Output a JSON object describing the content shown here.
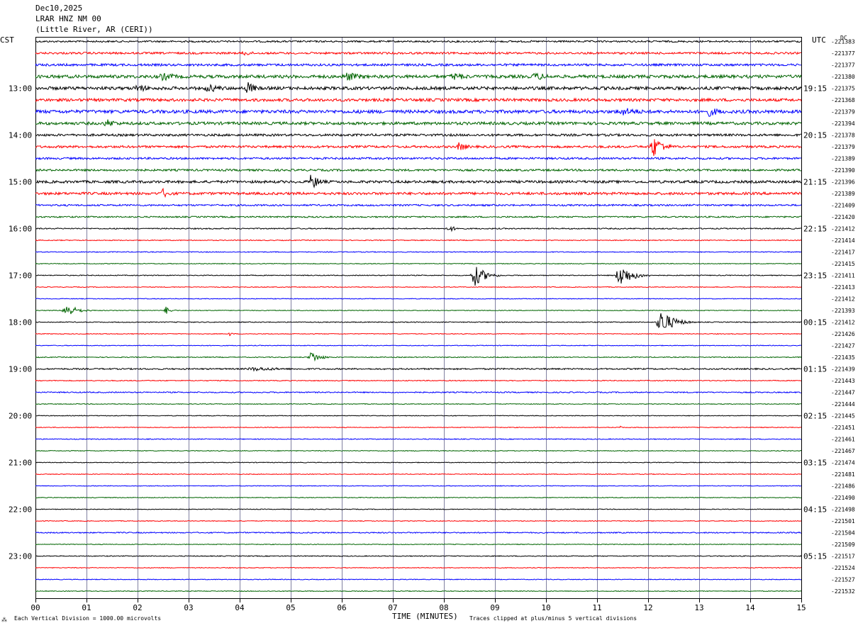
{
  "header": {
    "date": "Dec10,2025",
    "station": "LRAR HNZ NM 00",
    "location": "(Little River, AR (CERI))"
  },
  "left_axis_title": "CST",
  "right_axis_title": "UTC",
  "dc_label": "DC",
  "footer": {
    "scale_note": "Each Vertical Division = 1000.00 microvolts",
    "xlabel": "TIME (MINUTES)",
    "clip_note": "Traces clipped at plus/minus 5 vertical divisions"
  },
  "colors": {
    "cycle": [
      "#000000",
      "#ff0000",
      "#0000ff",
      "#006400"
    ],
    "grid": "#8080a0"
  },
  "chart_data": {
    "type": "line",
    "title": "LRAR HNZ NM 00 (Little River, AR (CERI)) Dec10,2025",
    "xlabel": "TIME (MINUTES)",
    "xlim": [
      0,
      15
    ],
    "x_ticks": [
      "00",
      "01",
      "02",
      "03",
      "04",
      "05",
      "06",
      "07",
      "08",
      "09",
      "10",
      "11",
      "12",
      "13",
      "14",
      "15"
    ],
    "cst_hour_labels": [
      "13:00",
      "14:00",
      "15:00",
      "16:00",
      "17:00",
      "18:00",
      "19:00",
      "20:00",
      "21:00",
      "22:00",
      "23:00"
    ],
    "utc_hour_labels": [
      "19:15",
      "20:15",
      "21:15",
      "22:15",
      "23:15",
      "00:15",
      "01:15",
      "02:15",
      "03:15",
      "04:15",
      "05:15"
    ],
    "dc_offsets": [
      "-221383",
      "-221377",
      "-221377",
      "-221380",
      "-221375",
      "-221368",
      "-221379",
      "-221394",
      "-221378",
      "-221379",
      "-221389",
      "-221390",
      "-221396",
      "-221389",
      "-221409",
      "-221420",
      "-221412",
      "-221414",
      "-221417",
      "-221415",
      "-221411",
      "-221413",
      "-221412",
      "-221393",
      "-221412",
      "-221426",
      "-221427",
      "-221435",
      "-221439",
      "-221443",
      "-221447",
      "-221444",
      "-221445",
      "-221451",
      "-221461",
      "-221467",
      "-221474",
      "-221481",
      "-221486",
      "-221490",
      "-221498",
      "-221501",
      "-221504",
      "-221509",
      "-221517",
      "-221524",
      "-221527",
      "-221532"
    ],
    "trace_noise": [
      1.2,
      1.4,
      1.6,
      2.2,
      2.2,
      2.0,
      2.3,
      2.0,
      1.6,
      1.6,
      1.4,
      1.4,
      1.8,
      1.8,
      1.2,
      1.0,
      0.8,
      0.6,
      0.6,
      0.5,
      0.6,
      0.5,
      0.5,
      0.5,
      0.6,
      0.5,
      0.5,
      0.6,
      1.0,
      0.6,
      0.8,
      0.5,
      0.5,
      0.5,
      0.6,
      0.5,
      0.5,
      0.5,
      0.5,
      0.5,
      0.5,
      0.5,
      0.8,
      0.5,
      0.6,
      0.5,
      0.5,
      0.5
    ],
    "events": [
      {
        "trace": 1,
        "minute": 4.1,
        "amp": 4,
        "dur": 0.6
      },
      {
        "trace": 3,
        "minute": 2.5,
        "amp": 6,
        "dur": 1.0
      },
      {
        "trace": 3,
        "minute": 6.1,
        "amp": 7,
        "dur": 1.0
      },
      {
        "trace": 3,
        "minute": 8.2,
        "amp": 6,
        "dur": 1.0
      },
      {
        "trace": 3,
        "minute": 9.8,
        "amp": 6,
        "dur": 1.0
      },
      {
        "trace": 4,
        "minute": 2.0,
        "amp": 6,
        "dur": 0.8
      },
      {
        "trace": 4,
        "minute": 3.4,
        "amp": 6,
        "dur": 1.0
      },
      {
        "trace": 4,
        "minute": 4.15,
        "amp": 10,
        "dur": 0.5
      },
      {
        "trace": 6,
        "minute": 11.5,
        "amp": 6,
        "dur": 1.5
      },
      {
        "trace": 6,
        "minute": 13.2,
        "amp": 7,
        "dur": 0.8
      },
      {
        "trace": 7,
        "minute": 1.4,
        "amp": 6,
        "dur": 0.8
      },
      {
        "trace": 9,
        "minute": 8.3,
        "amp": 7,
        "dur": 0.5
      },
      {
        "trace": 9,
        "minute": 12.1,
        "amp": 16,
        "dur": 0.6
      },
      {
        "trace": 12,
        "minute": 5.4,
        "amp": 12,
        "dur": 0.5
      },
      {
        "trace": 13,
        "minute": 2.5,
        "amp": 7,
        "dur": 0.5
      },
      {
        "trace": 16,
        "minute": 8.1,
        "amp": 5,
        "dur": 0.4
      },
      {
        "trace": 20,
        "minute": 8.6,
        "amp": 16,
        "dur": 0.6
      },
      {
        "trace": 20,
        "minute": 11.45,
        "amp": 16,
        "dur": 0.7
      },
      {
        "trace": 23,
        "minute": 0.6,
        "amp": 10,
        "dur": 0.6
      },
      {
        "trace": 23,
        "minute": 2.55,
        "amp": 6,
        "dur": 0.3
      },
      {
        "trace": 24,
        "minute": 12.25,
        "amp": 18,
        "dur": 0.7
      },
      {
        "trace": 25,
        "minute": 3.8,
        "amp": 3,
        "dur": 0.2
      },
      {
        "trace": 27,
        "minute": 5.4,
        "amp": 9,
        "dur": 0.5
      },
      {
        "trace": 28,
        "minute": 4.3,
        "amp": 3,
        "dur": 2.0
      },
      {
        "trace": 33,
        "minute": 11.45,
        "amp": 3,
        "dur": 0.1
      }
    ]
  }
}
